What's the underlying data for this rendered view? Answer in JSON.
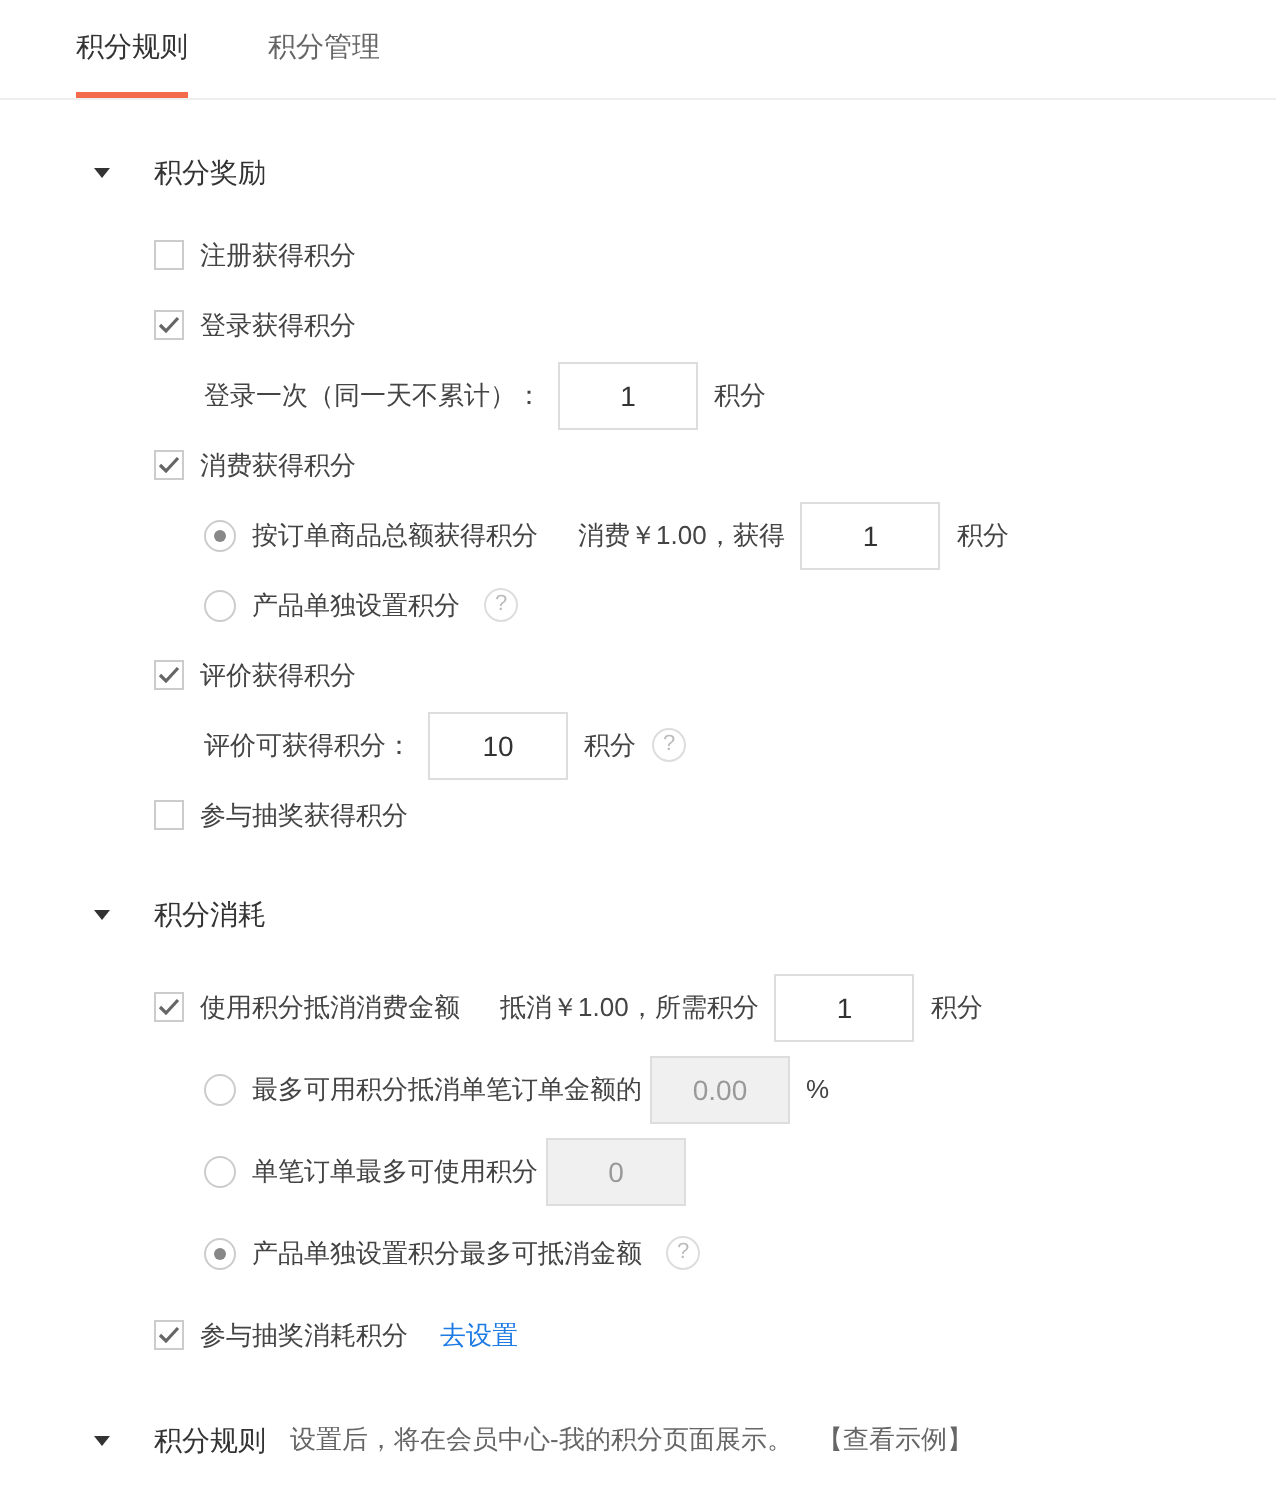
{
  "tabs": [
    {
      "label": "积分规则",
      "selected": true
    },
    {
      "label": "积分管理",
      "selected": false
    }
  ],
  "sections": [
    {
      "title": "积分奖励",
      "expanded": true,
      "items": [
        {
          "kind": "checkbox",
          "label": "注册获得积分",
          "checked": false
        },
        {
          "kind": "checkbox",
          "label": "登录获得积分",
          "checked": true
        },
        {
          "kind": "field",
          "label": "登录一次（同一天不累计）：",
          "value": "1",
          "unit": "积分"
        },
        {
          "kind": "checkbox",
          "label": "消费获得积分",
          "checked": true
        },
        {
          "kind": "radio",
          "label": "按订单商品总额获得积分",
          "selected": true,
          "note": "消费￥1.00，获得",
          "value": "1",
          "unit": "积分"
        },
        {
          "kind": "radio",
          "label": "产品单独设置积分",
          "selected": false,
          "help": "?"
        },
        {
          "kind": "checkbox",
          "label": "评价获得积分",
          "checked": true
        },
        {
          "kind": "field",
          "label": "评价可获得积分：",
          "value": "10",
          "unit": "积分",
          "help": "?"
        },
        {
          "kind": "checkbox",
          "label": "参与抽奖获得积分",
          "checked": false
        }
      ]
    },
    {
      "title": "积分消耗",
      "expanded": true,
      "items": [
        {
          "kind": "checkbox",
          "label": "使用积分抵消消费金额",
          "checked": true,
          "note": "抵消￥1.00，所需积分",
          "value": "1",
          "unit": "积分"
        },
        {
          "kind": "radio",
          "label": "最多可用积分抵消单笔订单金额的",
          "selected": false,
          "disabled": true,
          "value": "0.00",
          "unit": "%"
        },
        {
          "kind": "radio",
          "label": "单笔订单最多可使用积分",
          "selected": false,
          "disabled": true,
          "value": "0"
        },
        {
          "kind": "radio",
          "label": "产品单独设置积分最多可抵消金额",
          "selected": true,
          "help": "?"
        },
        {
          "kind": "checkbox",
          "label": "参与抽奖消耗积分",
          "checked": true,
          "link": "去设置"
        }
      ]
    },
    {
      "title": "积分规则",
      "expanded": true,
      "note": "设置后，将在会员中心-我的积分页面展示。",
      "link": "【查看示例】"
    }
  ]
}
